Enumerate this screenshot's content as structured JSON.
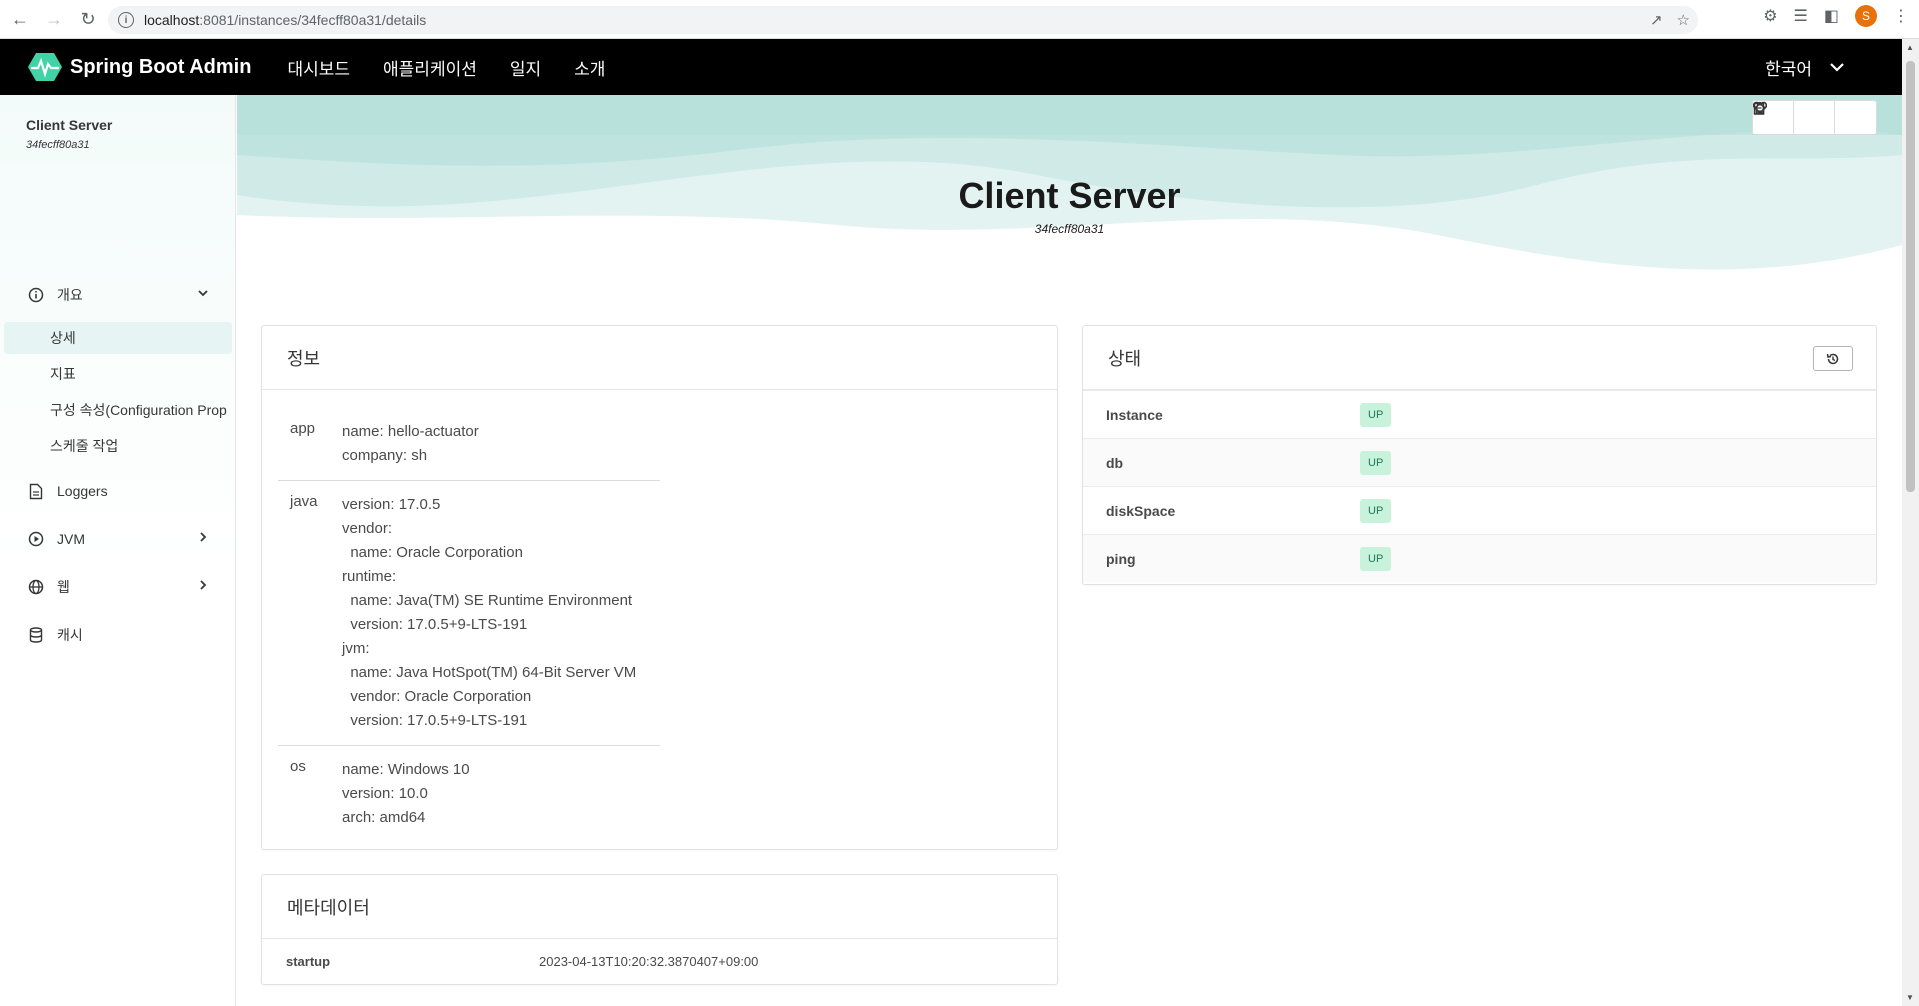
{
  "browser": {
    "url_host": "localhost",
    "url_path": ":8081/instances/34fecff80a31/details",
    "profile_initial": "S"
  },
  "app": {
    "brand": "Spring Boot Admin",
    "nav": [
      "대시보드",
      "애플리케이션",
      "일지",
      "소개"
    ],
    "language": "한국어"
  },
  "sidebar": {
    "title": "Client Server",
    "instance_id": "34fecff80a31",
    "overview_label": "개요",
    "sub_items": [
      "상세",
      "지표",
      "구성 속성(Configuration Prop",
      "스케줄 작업"
    ],
    "items": [
      {
        "label": "Loggers",
        "icon": "file-icon"
      },
      {
        "label": "JVM",
        "icon": "play-circle-icon"
      },
      {
        "label": "웹",
        "icon": "globe-icon"
      },
      {
        "label": "캐시",
        "icon": "database-icon"
      }
    ]
  },
  "header": {
    "title": "Client Server",
    "instance_id": "34fecff80a31"
  },
  "info_card": {
    "title": "정보",
    "rows": [
      {
        "key": "app",
        "value": "name: hello-actuator\ncompany: sh"
      },
      {
        "key": "java",
        "value": "version: 17.0.5\nvendor:\n  name: Oracle Corporation\nruntime:\n  name: Java(TM) SE Runtime Environment\n  version: 17.0.5+9-LTS-191\njvm:\n  name: Java HotSpot(TM) 64-Bit Server VM\n  vendor: Oracle Corporation\n  version: 17.0.5+9-LTS-191"
      },
      {
        "key": "os",
        "value": "name: Windows 10\nversion: 10.0\narch: amd64"
      }
    ]
  },
  "health_card": {
    "title": "상태",
    "rows": [
      {
        "name": "Instance",
        "status": "UP"
      },
      {
        "name": "db",
        "status": "UP"
      },
      {
        "name": "diskSpace",
        "status": "UP"
      },
      {
        "name": "ping",
        "status": "UP"
      }
    ]
  },
  "metadata_card": {
    "title": "메타데이터",
    "rows": [
      {
        "key": "startup",
        "value": "2023-04-13T10:20:32.3870407+09:00"
      }
    ]
  },
  "colors": {
    "nav_bg": "#000000",
    "accent": "#42d3a5",
    "badge_bg": "#c9f2dd",
    "hero_wave": "#b9e3df"
  }
}
